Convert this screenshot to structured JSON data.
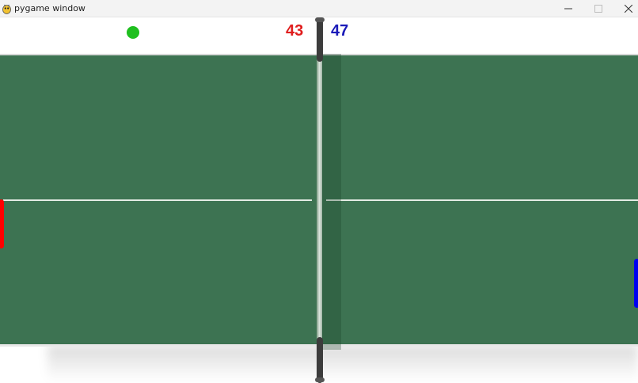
{
  "window": {
    "title": "pygame window",
    "app_icon": "pygame-snake-icon",
    "controls": [
      "minimize-icon",
      "maximize-icon",
      "close-icon"
    ]
  },
  "game": {
    "scores": {
      "left": "43",
      "right": "47"
    },
    "colors": {
      "table": "#3d7352",
      "left_score": "#e01e1e",
      "right_score": "#1a1ab8",
      "ball": "#1fbf1f",
      "left_paddle": "#ff0000",
      "right_paddle": "#0000ee",
      "net_post": "#3c3c3c"
    }
  }
}
